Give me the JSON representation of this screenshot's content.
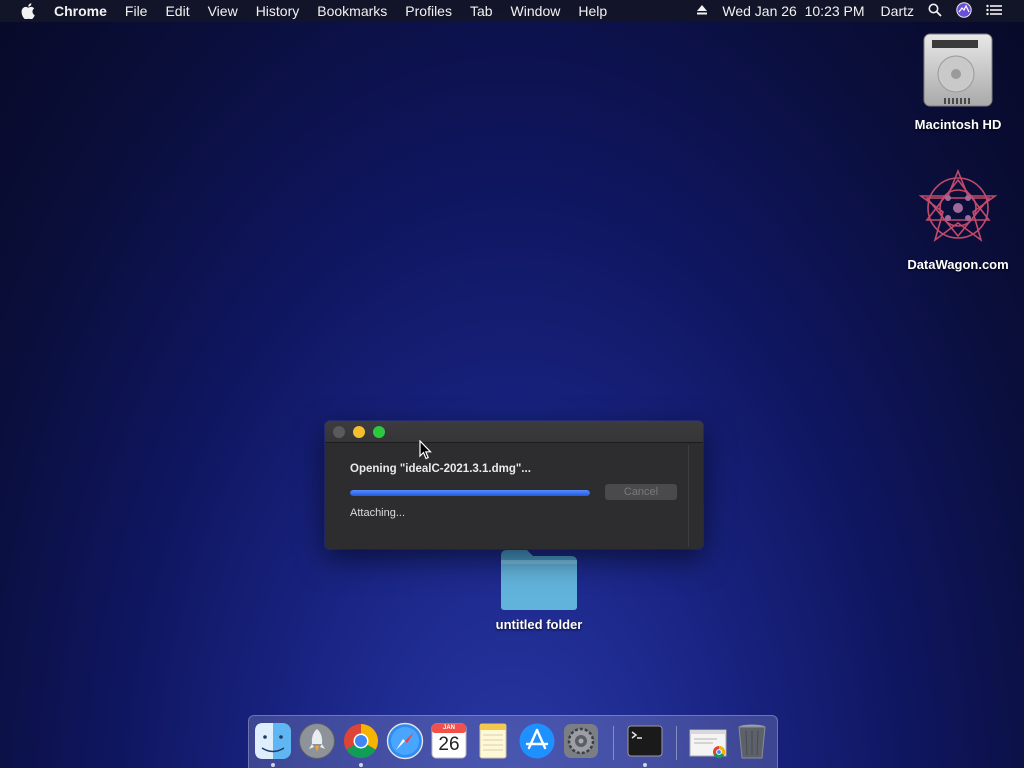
{
  "menubar": {
    "app_name": "Chrome",
    "menus": [
      "File",
      "Edit",
      "View",
      "History",
      "Bookmarks",
      "Profiles",
      "Tab",
      "Window",
      "Help"
    ],
    "clock": "Wed Jan 26  10:23 PM",
    "user": "Dartz",
    "icons": [
      "apple-icon",
      "eject-icon",
      "search-icon",
      "siri-icon",
      "control-center-icon"
    ]
  },
  "desktop": {
    "icons": [
      {
        "label": "Macintosh HD",
        "icon": "hard-drive-icon"
      },
      {
        "label": "DataWagon.com",
        "icon": "datawagon-logo-icon"
      },
      {
        "label": "untitled folder",
        "icon": "folder-icon"
      }
    ]
  },
  "dialog": {
    "opening_text": "Opening \"idealC-2021.3.1.dmg\"...",
    "progress": 1.0,
    "cancel_label": "Cancel",
    "status_text": "Attaching..."
  },
  "dock": {
    "apps": [
      {
        "name": "Finder",
        "icon": "finder-icon",
        "running": true
      },
      {
        "name": "Launchpad",
        "icon": "launchpad-icon",
        "running": false
      },
      {
        "name": "Chrome",
        "icon": "chrome-icon",
        "running": true
      },
      {
        "name": "Safari",
        "icon": "safari-icon",
        "running": false
      },
      {
        "name": "Calendar",
        "icon": "calendar-icon",
        "running": false,
        "month": "JAN",
        "day": "26"
      },
      {
        "name": "Notes",
        "icon": "notes-icon",
        "running": false
      },
      {
        "name": "App Store",
        "icon": "app-store-icon",
        "running": false
      },
      {
        "name": "System Preferences",
        "icon": "system-preferences-icon",
        "running": false
      },
      {
        "name": "Terminal",
        "icon": "terminal-icon",
        "running": true
      },
      {
        "name": "Chrome Downloads",
        "icon": "chrome-document-icon",
        "running": false
      },
      {
        "name": "Trash",
        "icon": "trash-icon",
        "running": false
      }
    ]
  },
  "colors": {
    "accent_progress": "#1f5ae0",
    "traffic_close": "#5a5a5c",
    "traffic_min": "#f5be2e",
    "traffic_max": "#2dc840"
  }
}
